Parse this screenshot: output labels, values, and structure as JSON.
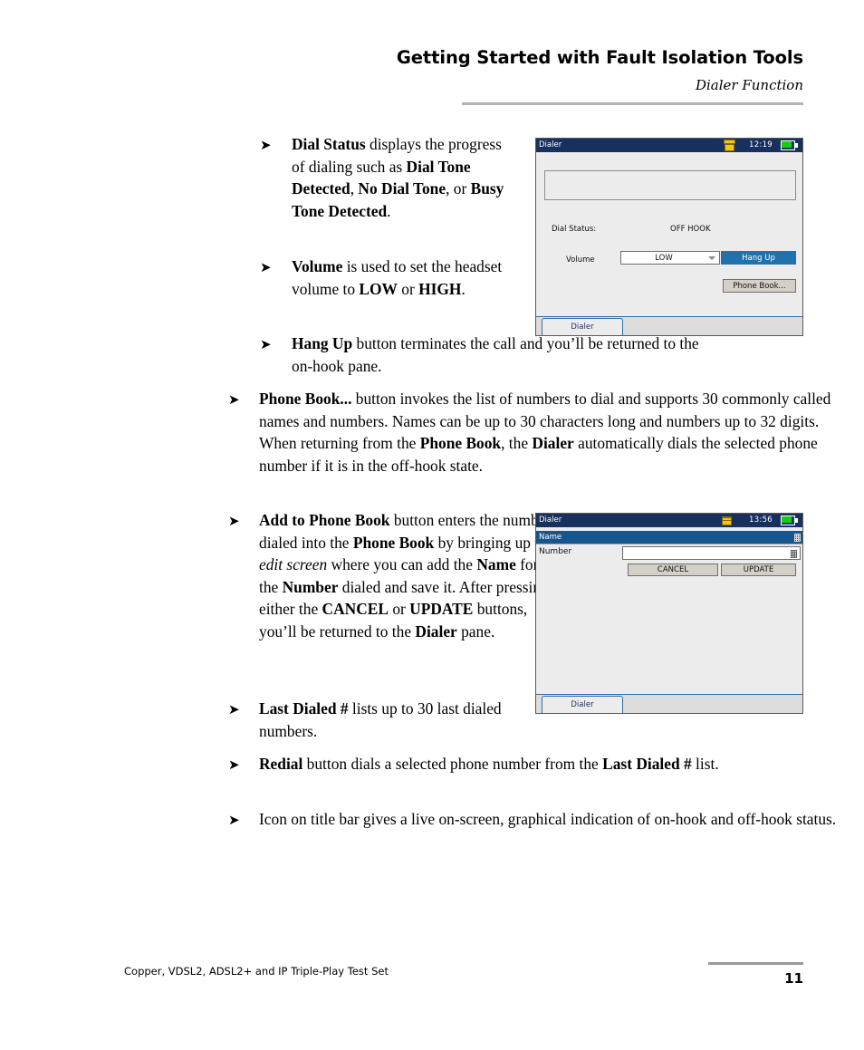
{
  "header": {
    "title": "Getting Started with Fault Isolation Tools",
    "subtitle": "Dialer Function"
  },
  "bullets": {
    "dial_status": {
      "arrow": "➤",
      "term": "Dial Status",
      "text_1": " displays the progress of dialing such as ",
      "term_2": "Dial Tone Detected",
      "text_2": ", ",
      "term_3": "No Dial Tone",
      "text_3": ", or ",
      "term_4": "Busy Tone Detected",
      "text_4": "."
    },
    "volume": {
      "term": "Volume",
      "text_1": " is used to set the headset volume to ",
      "term_2": "LOW",
      "text_2": " or ",
      "term_3": "HIGH",
      "text_3": "."
    },
    "hang_up": {
      "term": "Hang Up",
      "text_1": " button terminates the call and you’ll be returned to the on-hook pane."
    },
    "phone_book": {
      "term": "Phone Book...",
      "text_1": " button invokes the list of numbers to dial and supports 30 commonly called names and numbers. Names can be up to 30 characters long and numbers up to 32 digits. When returning from the ",
      "term_2": "Phone Book",
      "text_2": ", the ",
      "term_3": "Dialer",
      "text_3": " automatically dials the selected phone number if it is in the off-hook state."
    },
    "add_to_phone_book": {
      "term": "Add to Phone Book",
      "text_1": " button enters the number dialed into the ",
      "term_2": "Phone Book",
      "text_2": " by bringing up the ",
      "term_italic": "edit screen",
      "text_3": " where you can add the ",
      "term_3": "Name",
      "text_4": " for the ",
      "term_4": "Number",
      "text_5": " dialed and save it. After pressing either the ",
      "term_5": "CANCEL",
      "text_6": " or ",
      "term_6": "UPDATE",
      "text_7": " buttons, you’ll be returned to the ",
      "term_7": "Dialer",
      "text_8": " pane."
    },
    "last_dialed": {
      "term": "Last Dialed #",
      "text_1": " lists up to 30 last dialed numbers."
    },
    "redial": {
      "term": "Redial",
      "text_1": " button dials a selected phone number from the ",
      "term_2": "Last Dialed #",
      "text_2": " list."
    },
    "icon_title_bar": {
      "text_1": "Icon on title bar gives a live on-screen, graphical indication of on-hook and off-hook status."
    }
  },
  "screenshot_dialer": {
    "title": "Dialer",
    "clock": "12:19",
    "phone_icon": "phone-off-hook-icon",
    "battery_icon": "battery-charging-icon",
    "dial_status_label": "Dial Status:",
    "dial_status_value": "OFF HOOK",
    "volume_label": "Volume",
    "volume_value": "LOW",
    "hang_up_label": "Hang Up",
    "phone_book_label": "Phone Book...",
    "tab_label": "Dialer"
  },
  "screenshot_edit": {
    "title": "Dialer",
    "clock": "13:56",
    "phone_icon": "phone-on-hook-icon",
    "battery_icon": "battery-charging-icon",
    "name_label": "Name",
    "name_value": "",
    "number_label": "Number",
    "number_value": "",
    "cancel_label": "CANCEL",
    "update_label": "UPDATE",
    "tab_label": "Dialer"
  },
  "footer": {
    "text": "Copper, VDSL2, ADSL2+ and IP Triple-Play Test Set",
    "page": "11"
  },
  "colors": {
    "titlebar": "#17305e",
    "accent_blue": "#1f72ad",
    "row_blue": "#17558f",
    "battery_green": "#19cc19",
    "phone_yellow": "#f5c518",
    "rule_grey": "#b3b3b3"
  }
}
